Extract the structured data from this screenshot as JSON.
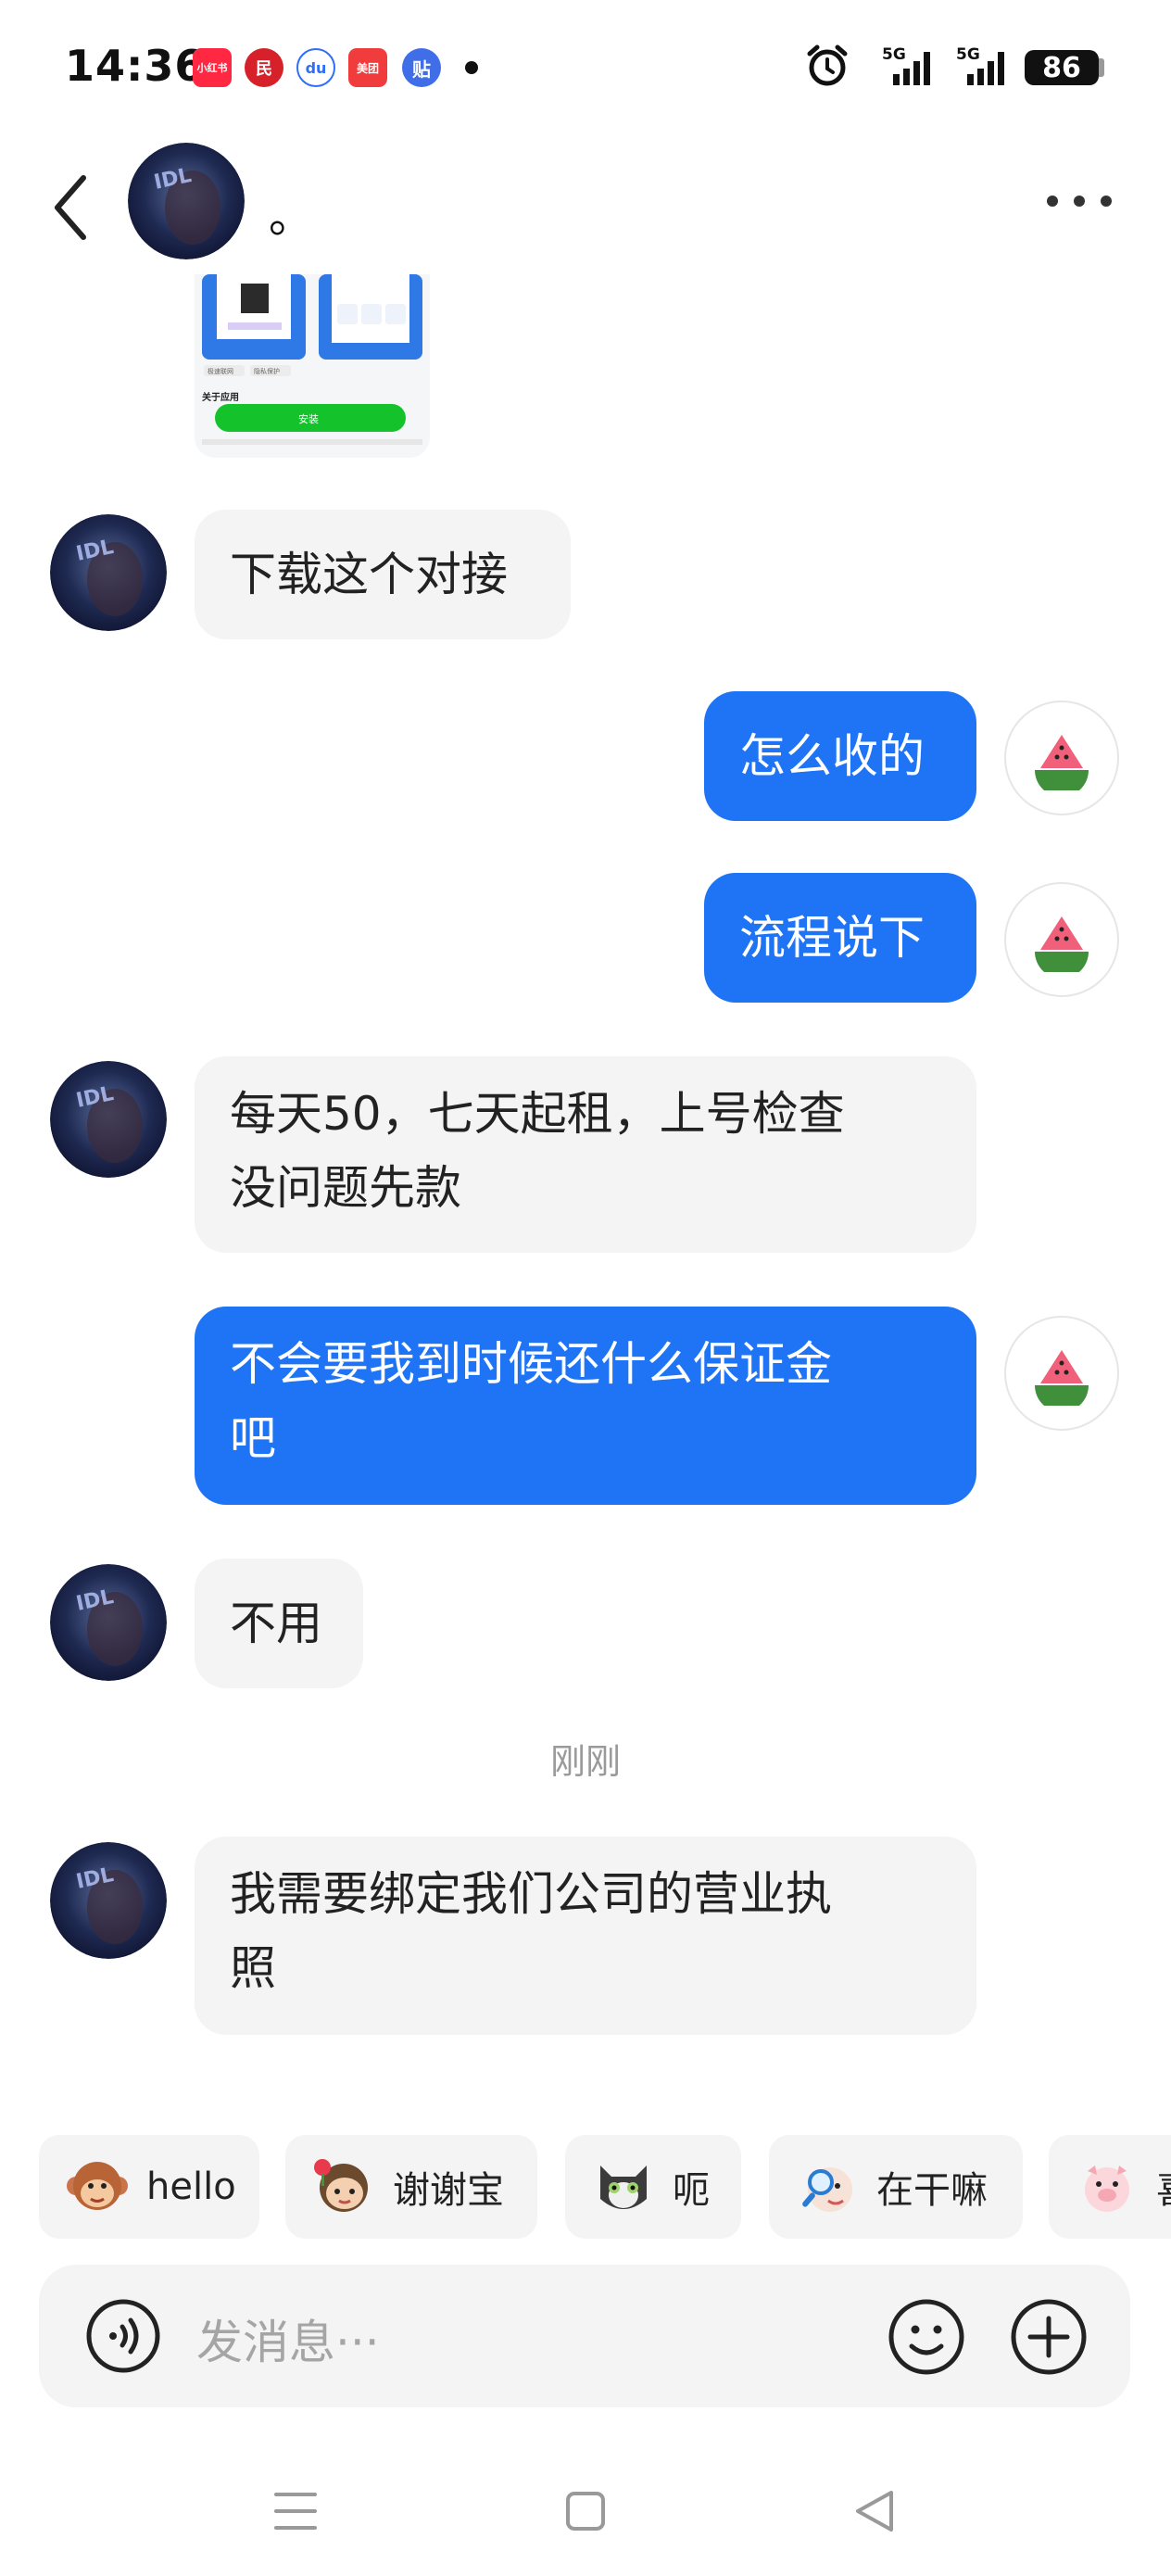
{
  "status_bar": {
    "time": "14:36",
    "apps": [
      "小红书",
      "民",
      "du",
      "美团",
      "贴"
    ],
    "signal_1": "5G",
    "signal_2": "5G",
    "battery": "86"
  },
  "header": {
    "contact_name": "。"
  },
  "shared_image": {
    "section_title": "关于应用",
    "install_label": "安装",
    "tags": [
      "极速联网",
      "隐私保护"
    ]
  },
  "messages": [
    {
      "side": "in",
      "text": "下载这个对接"
    },
    {
      "side": "out",
      "text": "怎么收的"
    },
    {
      "side": "out",
      "text": "流程说下"
    },
    {
      "side": "in",
      "line1": "每天50，七天起租，上号检查",
      "line2": "没问题先款"
    },
    {
      "side": "out",
      "line1": "不会要我到时候还什么保证金",
      "line2": "吧"
    },
    {
      "side": "in",
      "text": "不用"
    },
    {
      "side": "in",
      "line1": "我需要绑定我们公司的营业执",
      "line2": "照"
    }
  ],
  "timestamp": "刚刚",
  "quick_replies": [
    {
      "label": "hello",
      "icon": "monkey-sticker-icon"
    },
    {
      "label": "谢谢宝",
      "icon": "girl-flower-sticker-icon"
    },
    {
      "label": "呃",
      "icon": "cat-sticker-icon"
    },
    {
      "label": "在干嘛",
      "icon": "magnifier-sticker-icon"
    },
    {
      "label": "喜",
      "icon": "pig-sticker-icon"
    }
  ],
  "input": {
    "placeholder": "发消息···"
  },
  "colors": {
    "outgoing_bubble": "#1e74f4",
    "incoming_bubble": "#f4f4f4",
    "background": "#ffffff"
  }
}
